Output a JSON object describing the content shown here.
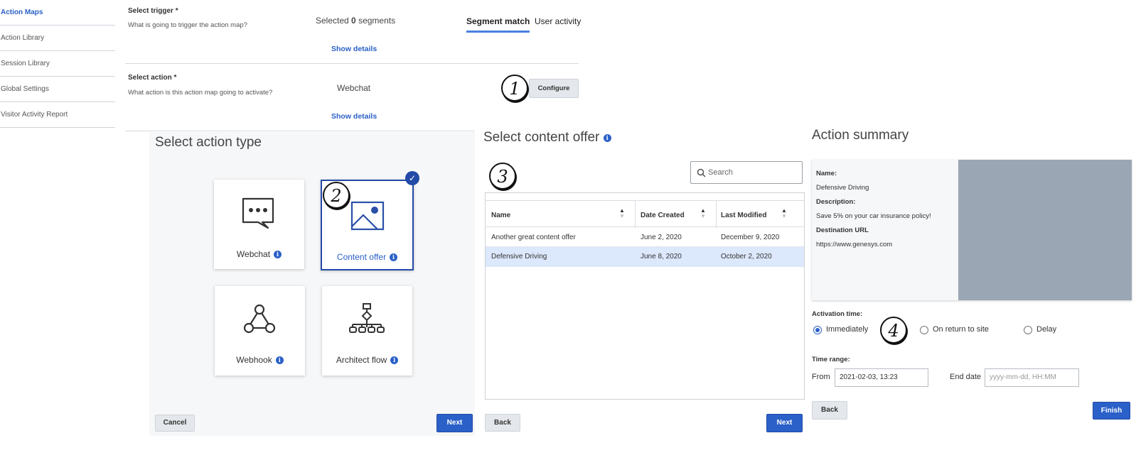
{
  "sidebar": {
    "items": [
      {
        "label": "Action Maps"
      },
      {
        "label": "Action Library"
      },
      {
        "label": "Session Library"
      },
      {
        "label": "Global Settings"
      },
      {
        "label": "Visitor Activity Report"
      }
    ]
  },
  "config": {
    "trigger": {
      "title": "Select trigger *",
      "subtitle": "What is going to trigger the action map?",
      "selected_prefix": "Selected ",
      "selected_count": "0",
      "selected_suffix": " segments",
      "show_details": "Show details",
      "tabs": [
        {
          "label": "Segment match",
          "active": true
        },
        {
          "label": "User activity",
          "active": false
        }
      ]
    },
    "action": {
      "title": "Select action *",
      "subtitle": "What action is this action map going to activate?",
      "value": "Webchat",
      "show_details": "Show details",
      "configure_label": "Configure"
    }
  },
  "action_type": {
    "title": "Select action type",
    "cards": [
      {
        "label": "Webchat",
        "icon": "chat-bubble-icon",
        "selected": false
      },
      {
        "label": "Content offer",
        "icon": "image-icon",
        "selected": true
      },
      {
        "label": "Webhook",
        "icon": "webhook-icon",
        "selected": false
      },
      {
        "label": "Architect flow",
        "icon": "flow-icon",
        "selected": false
      }
    ],
    "cancel_label": "Cancel",
    "next_label": "Next"
  },
  "content_offer": {
    "title": "Select content offer",
    "search_placeholder": "Search",
    "columns": [
      "Name",
      "Date Created",
      "Last Modified"
    ],
    "rows": [
      {
        "name": "Another great content offer",
        "created": "June 2, 2020",
        "modified": "December 9, 2020",
        "selected": false
      },
      {
        "name": "Defensive Driving",
        "created": "June 8, 2020",
        "modified": "October 2, 2020",
        "selected": true
      }
    ],
    "back_label": "Back",
    "next_label": "Next"
  },
  "summary": {
    "title": "Action summary",
    "name_label": "Name:",
    "name_value": "Defensive Driving",
    "description_label": "Description:",
    "description_value": "Save 5% on your car insurance policy!",
    "url_label": "Destination URL",
    "url_value": "https://www.genesys.com",
    "activation_label": "Activation time:",
    "activation_options": [
      {
        "label": "Immediately",
        "selected": true
      },
      {
        "label": "On return to site",
        "selected": false
      },
      {
        "label": "Delay",
        "selected": false
      }
    ],
    "time_range_label": "Time range:",
    "from_label": "From",
    "from_value": "2021-02-03, 13:23",
    "end_label": "End date",
    "end_placeholder": "yyyy-mm-dd, HH:MM",
    "back_label": "Back",
    "finish_label": "Finish"
  },
  "callouts": [
    "1",
    "2",
    "3",
    "4"
  ],
  "colors": {
    "accent": "#2a60c8",
    "selected_row": "#dce8fb",
    "panel_bg": "#f6f7f8",
    "preview_gray": "#9aa6b4"
  }
}
